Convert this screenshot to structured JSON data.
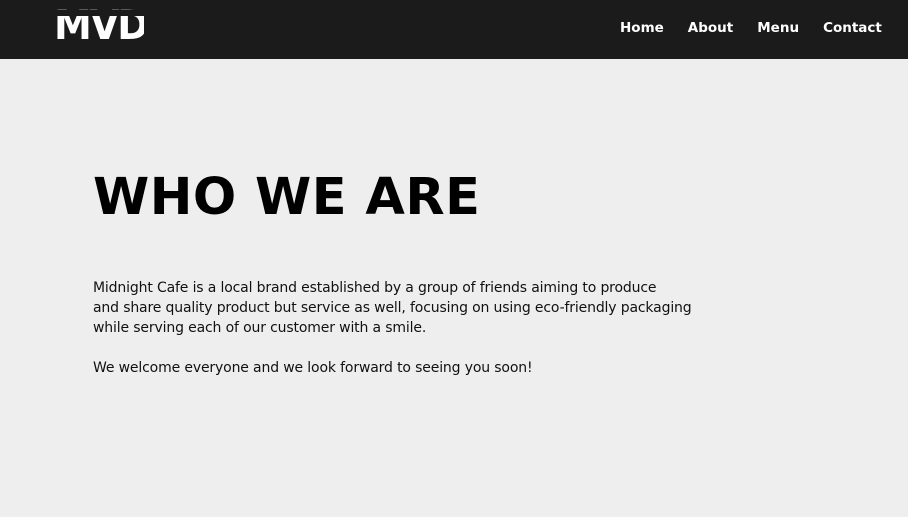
{
  "header": {
    "logo_text": "MVD",
    "nav": [
      {
        "label": "Home"
      },
      {
        "label": "About"
      },
      {
        "label": "Menu"
      },
      {
        "label": "Contact"
      }
    ]
  },
  "main": {
    "title": "WHO WE ARE",
    "paragraph_lines": [
      "Midnight Cafe is a local brand established by a group of friends aiming to produce",
      "and share quality product but service as well, focusing on using eco-friendly packaging",
      "while serving each of our customer with a smile."
    ],
    "welcome": "We welcome everyone and we look forward to seeing you soon!"
  },
  "colors": {
    "navbar_bg": "#1b1b1b",
    "page_bg": "#eeeeee",
    "nav_text": "#ffffff",
    "body_text": "#111111"
  }
}
